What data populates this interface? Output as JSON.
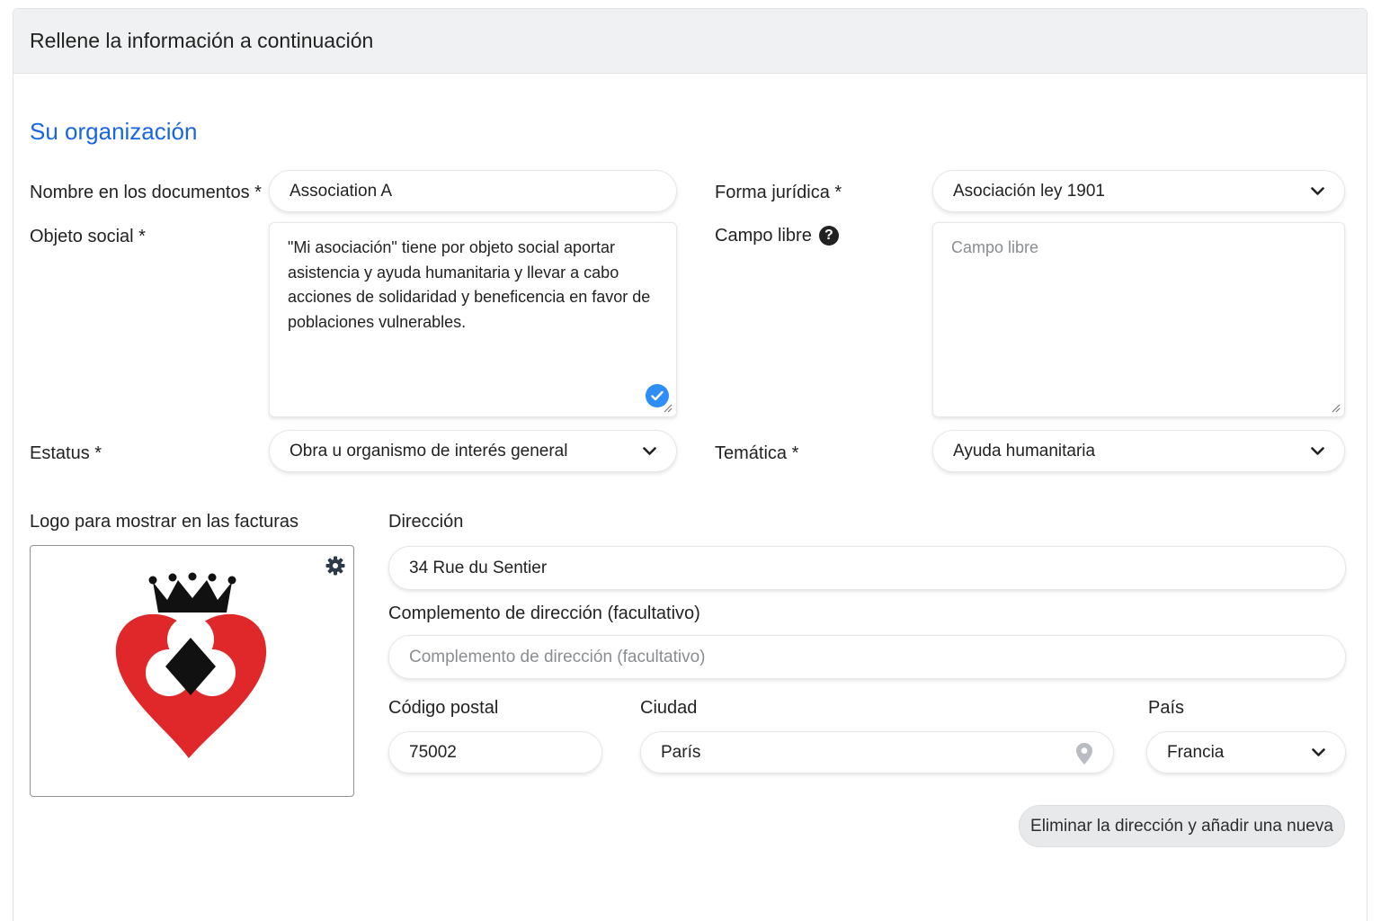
{
  "header": {
    "title": "Rellene la información a continuación"
  },
  "section": {
    "title": "Su organización"
  },
  "fields": {
    "nombre": {
      "label": "Nombre en los documentos *",
      "value": "Association A"
    },
    "forma": {
      "label": "Forma jurídica *",
      "value": "Asociación ley 1901"
    },
    "objeto": {
      "label": "Objeto social *",
      "value": "\"Mi asociación\" tiene por objeto social aportar asistencia y ayuda humanitaria y llevar a cabo acciones de solidaridad y beneficencia en favor de poblaciones vulnerables."
    },
    "campo": {
      "label": "Campo libre",
      "help": "?",
      "placeholder": "Campo libre"
    },
    "estatus": {
      "label": "Estatus *",
      "value": "Obra u organismo de interés general"
    },
    "tematica": {
      "label": "Temática *",
      "value": "Ayuda humanitaria"
    }
  },
  "logo": {
    "label": "Logo para mostrar en las facturas"
  },
  "address": {
    "label": "Dirección",
    "value": "34 Rue du Sentier",
    "complement_label": "Complemento de dirección (facultativo)",
    "complement_placeholder": "Complemento de dirección (facultativo)",
    "postal_label": "Código postal",
    "postal_value": "75002",
    "city_label": "Ciudad",
    "city_value": "París",
    "country_label": "País",
    "country_value": "Francia",
    "delete_button": "Eliminar la dirección y añadir una nueva"
  },
  "colors": {
    "accent": "#1a66e0",
    "check": "#2f8ef5",
    "logo_red": "#e0282a"
  },
  "icons": [
    "chevron-down-icon",
    "help-icon",
    "check-circle-icon",
    "resize-handle-icon",
    "gear-icon",
    "map-pin-icon"
  ]
}
